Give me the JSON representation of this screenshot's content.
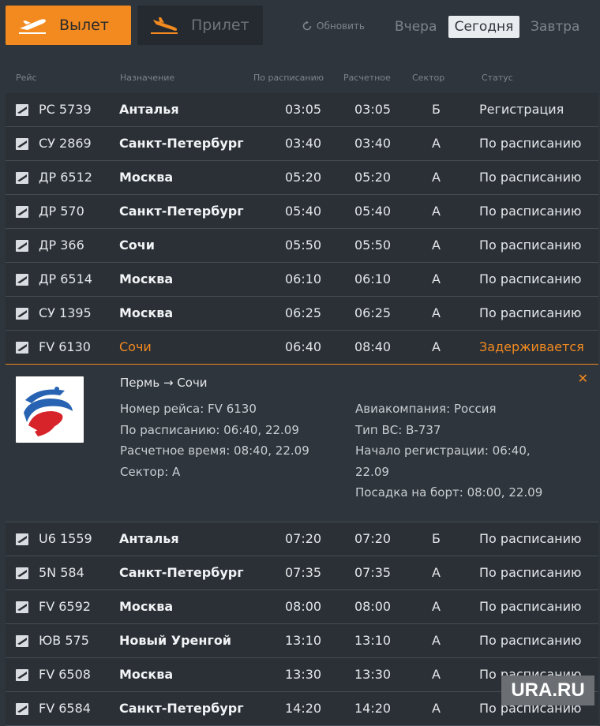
{
  "tabs": {
    "departures": "Вылет",
    "arrivals": "Прилет",
    "refresh": "Обновить"
  },
  "days": {
    "yesterday": "Вчера",
    "today": "Сегодня",
    "tomorrow": "Завтра"
  },
  "columns": {
    "flight": "Рейс",
    "destination": "Назначение",
    "scheduled": "По расписанию",
    "estimated": "Расчетное",
    "sector": "Сектор",
    "status": "Статус"
  },
  "flights": [
    {
      "flight": "РС 5739",
      "dest": "Анталья",
      "sched": "03:05",
      "est": "03:05",
      "sector": "Б",
      "status": "Регистрация"
    },
    {
      "flight": "СУ 2869",
      "dest": "Санкт-Петербург",
      "sched": "03:40",
      "est": "03:40",
      "sector": "А",
      "status": "По расписанию"
    },
    {
      "flight": "ДР 6512",
      "dest": "Москва",
      "sched": "05:20",
      "est": "05:20",
      "sector": "А",
      "status": "По расписанию"
    },
    {
      "flight": "ДР 570",
      "dest": "Санкт-Петербург",
      "sched": "05:40",
      "est": "05:40",
      "sector": "А",
      "status": "По расписанию"
    },
    {
      "flight": "ДР 366",
      "dest": "Сочи",
      "sched": "05:50",
      "est": "05:50",
      "sector": "А",
      "status": "По расписанию"
    },
    {
      "flight": "ДР 6514",
      "dest": "Москва",
      "sched": "06:10",
      "est": "06:10",
      "sector": "А",
      "status": "По расписанию"
    },
    {
      "flight": "СУ 1395",
      "dest": "Москва",
      "sched": "06:25",
      "est": "06:25",
      "sector": "А",
      "status": "По расписанию"
    },
    {
      "flight": "FV 6130",
      "dest": "Сочи",
      "sched": "06:40",
      "est": "08:40",
      "sector": "А",
      "status": "Задерживается"
    },
    {
      "flight": "U6 1559",
      "dest": "Анталья",
      "sched": "07:20",
      "est": "07:20",
      "sector": "Б",
      "status": "По расписанию"
    },
    {
      "flight": "5N 584",
      "dest": "Санкт-Петербург",
      "sched": "07:35",
      "est": "07:35",
      "sector": "А",
      "status": "По расписанию"
    },
    {
      "flight": "FV 6592",
      "dest": "Москва",
      "sched": "08:00",
      "est": "08:00",
      "sector": "А",
      "status": "По расписанию"
    },
    {
      "flight": "ЮВ 575",
      "dest": "Новый Уренгой",
      "sched": "13:10",
      "est": "13:10",
      "sector": "А",
      "status": "По расписанию"
    },
    {
      "flight": "FV 6508",
      "dest": "Москва",
      "sched": "13:30",
      "est": "13:30",
      "sector": "А",
      "status": "По расписанию"
    },
    {
      "flight": "FV 6584",
      "dest": "Санкт-Петербург",
      "sched": "14:20",
      "est": "14:20",
      "sector": "А",
      "status": "По расписанию"
    }
  ],
  "detail": {
    "route": "Пермь → Сочи",
    "flight_number": "Номер рейса: FV 6130",
    "scheduled": "По расписанию: 06:40, 22.09",
    "estimated": "Расчетное время: 08:40, 22.09",
    "sector": "Сектор: А",
    "airline": "Авиакомпания: Россия",
    "aircraft": "Тип ВС: B-737",
    "checkin_start": "Начало регистрации: 06:40,",
    "checkin_date": "22.09",
    "boarding": "Посадка на борт: 08:00, 22.09"
  },
  "brand": "URA.RU",
  "colors": {
    "accent": "#f38a1f",
    "background": "#2f353c",
    "row": "#2a3036"
  }
}
